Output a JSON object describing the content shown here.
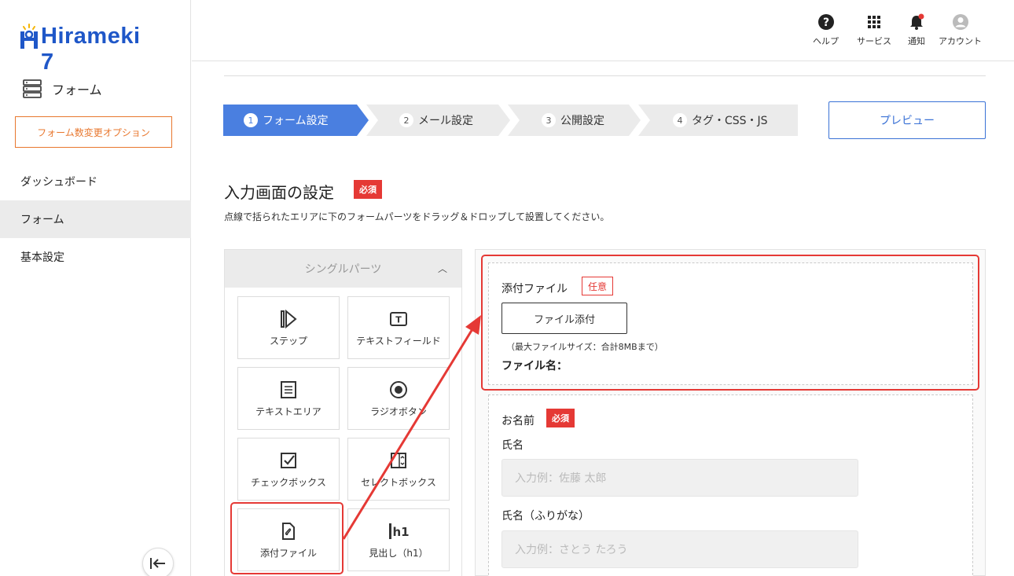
{
  "app": {
    "logo_text": "Hirameki 7"
  },
  "sidebar": {
    "title": "フォーム",
    "option_button": "フォーム数変更オプション",
    "nav": [
      {
        "label": "ダッシュボード",
        "active": false
      },
      {
        "label": "フォーム",
        "active": true
      },
      {
        "label": "基本設定",
        "active": false
      }
    ]
  },
  "header": {
    "help": "ヘルプ",
    "services": "サービス",
    "notifications": "通知",
    "account": "アカウント"
  },
  "steps": [
    {
      "num": "1",
      "label": "フォーム設定",
      "active": true
    },
    {
      "num": "2",
      "label": "メール設定",
      "active": false
    },
    {
      "num": "3",
      "label": "公開設定",
      "active": false
    },
    {
      "num": "4",
      "label": "タグ・CSS・JS",
      "active": false
    }
  ],
  "preview_button": "プレビュー",
  "section": {
    "title": "入力画面の設定",
    "badge": "必須",
    "description": "点線で括られたエリアに下のフォームパーツをドラッグ＆ドロップして設置してください。"
  },
  "parts": {
    "header": "シングルパーツ",
    "items": [
      {
        "label": "ステップ",
        "icon": "step-icon"
      },
      {
        "label": "テキストフィールド",
        "icon": "text-field-icon"
      },
      {
        "label": "テキストエリア",
        "icon": "text-area-icon"
      },
      {
        "label": "ラジオボタン",
        "icon": "radio-icon"
      },
      {
        "label": "チェックボックス",
        "icon": "checkbox-icon"
      },
      {
        "label": "セレクトボックス",
        "icon": "select-icon"
      },
      {
        "label": "添付ファイル",
        "icon": "attachment-icon"
      },
      {
        "label": "見出し（h1）",
        "icon": "h1-icon",
        "icon_text": "h1"
      }
    ]
  },
  "form": {
    "attachment": {
      "label": "添付ファイル",
      "badge": "任意",
      "button": "ファイル添付",
      "note": "（最大ファイルサイズ：合計8MBまで）",
      "filename_label": "ファイル名："
    },
    "name": {
      "label": "お名前",
      "badge": "必須",
      "field1_label": "氏名",
      "field1_placeholder": "入力例：佐藤 太郎",
      "field2_label": "氏名（ふりがな）",
      "field2_placeholder": "入力例：さとう たろう"
    }
  },
  "colors": {
    "brand": "#1f57c8",
    "accent": "#3a72d6",
    "active_step": "#4a7fe0",
    "required": "#e53935",
    "option_orange": "#e8772e"
  }
}
